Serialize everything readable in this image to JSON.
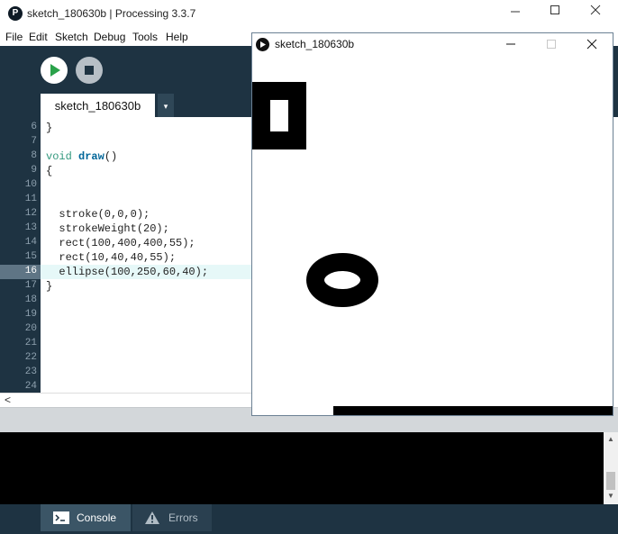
{
  "window": {
    "title": "sketch_180630b | Processing 3.3.7",
    "app_icon_glyph": "P"
  },
  "menu": {
    "items": [
      "File",
      "Edit",
      "Sketch",
      "Debug",
      "Tools",
      "Help"
    ]
  },
  "toolbar": {
    "run_icon": "play-icon",
    "stop_icon": "stop-icon"
  },
  "tabs": {
    "active": "sketch_180630b",
    "menu_glyph": "▾"
  },
  "editor": {
    "line_numbers": [
      "6",
      "7",
      "8",
      "9",
      "10",
      "11",
      "12",
      "13",
      "14",
      "15",
      "16",
      "17",
      "18",
      "19",
      "20",
      "21",
      "22",
      "23",
      "24"
    ],
    "active_line": "16",
    "lines": {
      "l6": "}",
      "l8_kw": "void",
      "l8_fn": "draw",
      "l8_rest": "()",
      "l9": "{",
      "l12": "  stroke(0,0,0);",
      "l13": "  strokeWeight(20);",
      "l14": "  rect(100,400,400,55);",
      "l15": "  rect(10,40,40,55);",
      "l16": "  ellipse(100,250,60,40);",
      "l17": "}"
    },
    "hscroll_glyph": "<"
  },
  "console": {
    "scroll_up": "▲",
    "scroll_down": "▼"
  },
  "status_tabs": {
    "console": "Console",
    "errors": "Errors"
  },
  "sketch_window": {
    "title": "sketch_180630b",
    "background": "#ffffff",
    "stroke": "#000000",
    "fill": "#ffffff"
  },
  "colors": {
    "ide_dark": "#1e3342",
    "line_highlight": "#e6f8f8",
    "keyword": "#33997e",
    "function": "#006699"
  }
}
